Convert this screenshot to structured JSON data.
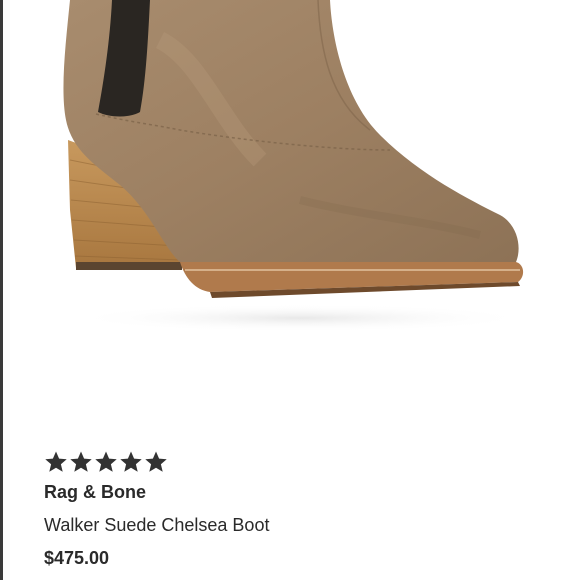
{
  "product": {
    "image_alt": "brown suede chelsea ankle boot with stacked wooden heel",
    "rating": {
      "stars": 5,
      "max": 5,
      "icon": "star-icon",
      "color": "#333333"
    },
    "brand": "Rag & Bone",
    "name": "Walker Suede Chelsea Boot",
    "price": "$475.00"
  }
}
